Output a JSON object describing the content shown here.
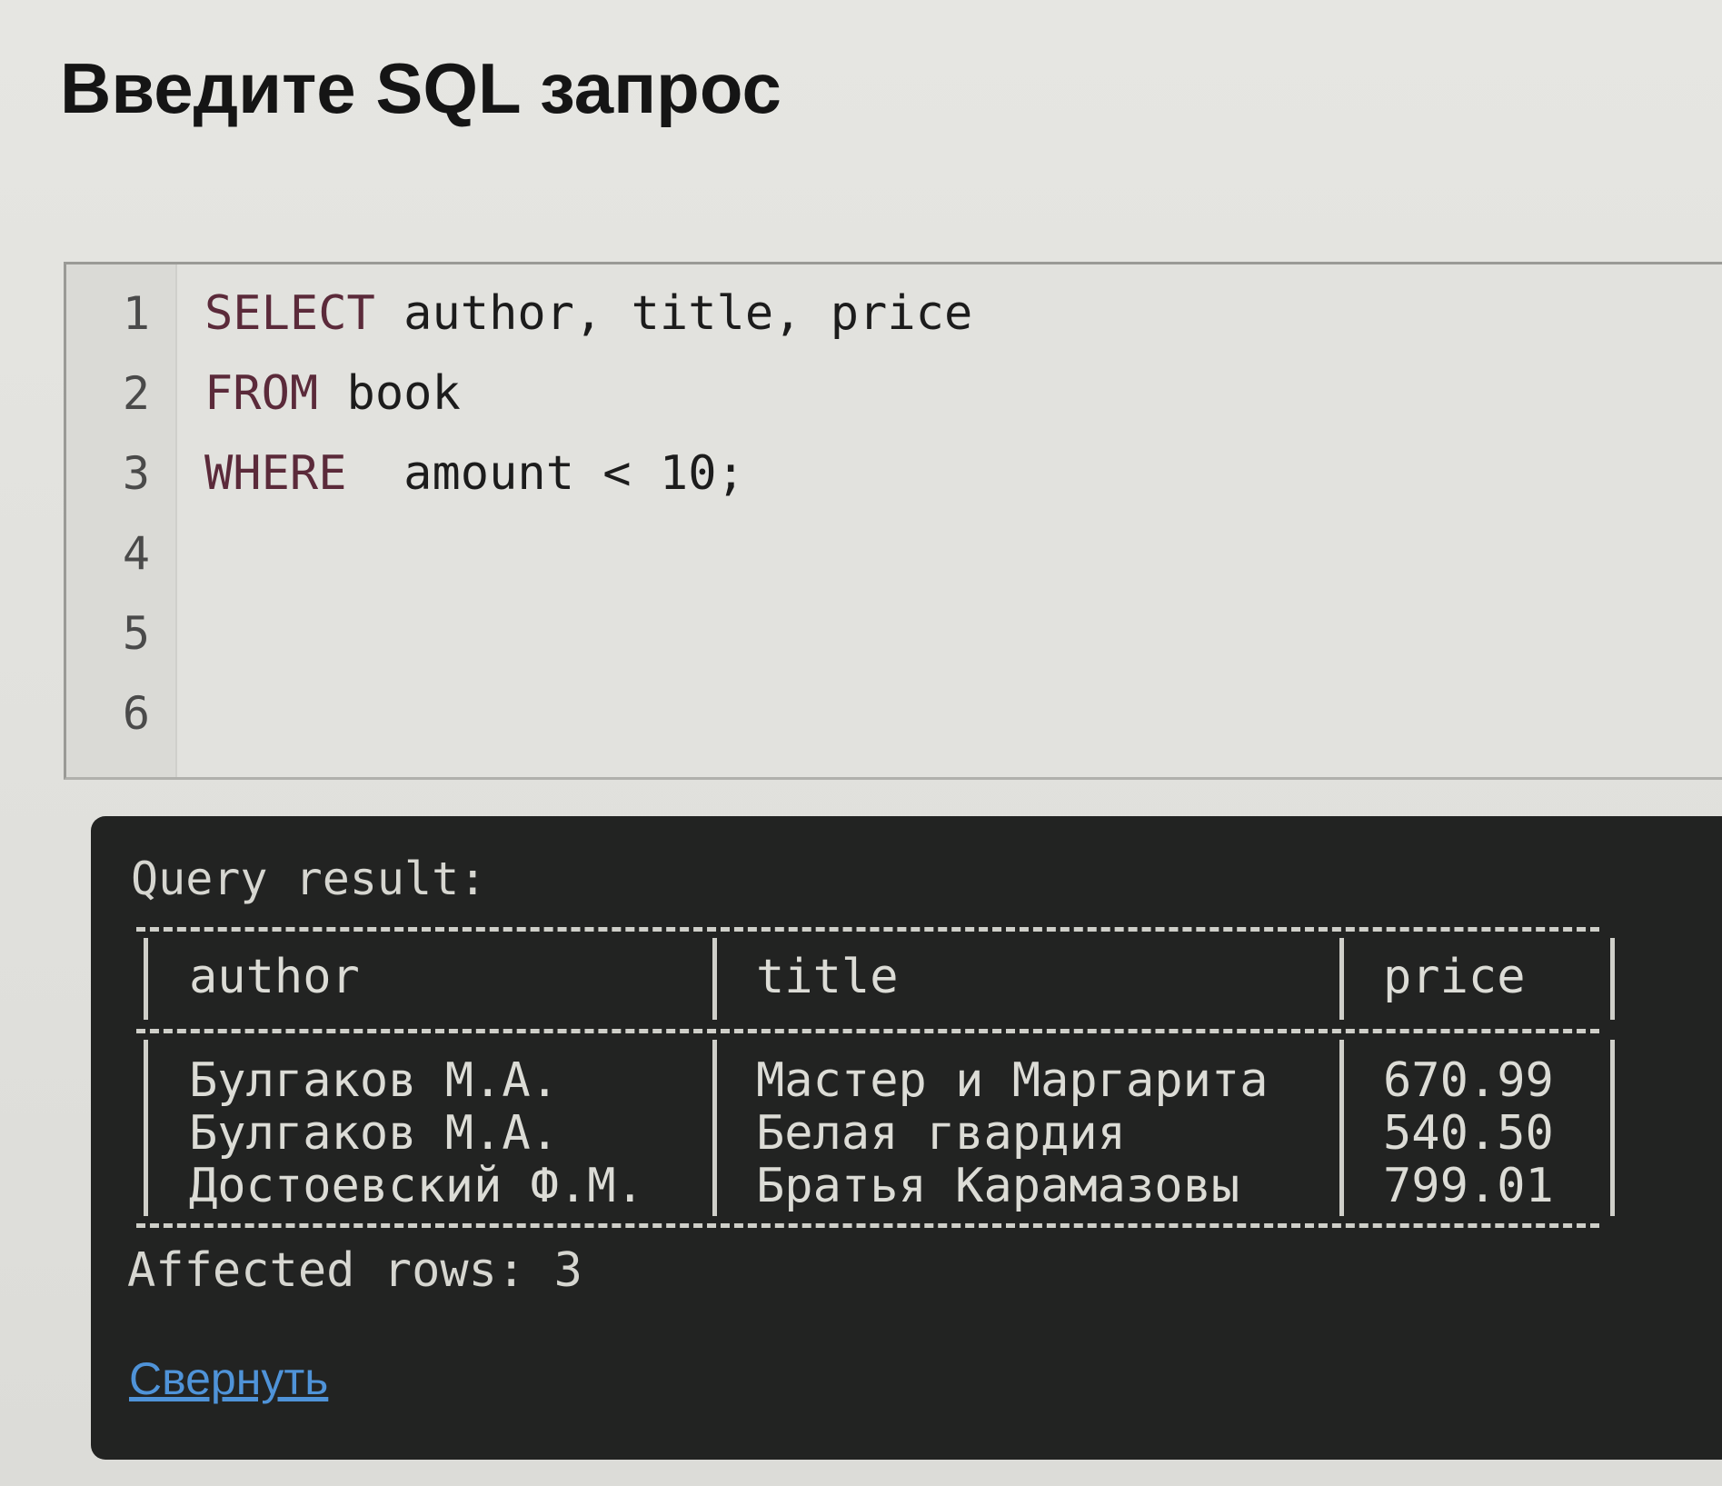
{
  "page": {
    "title": "Введите SQL запрос"
  },
  "editor": {
    "lines": [
      {
        "num": "1",
        "keyword": "SELECT",
        "rest": " author, title, price"
      },
      {
        "num": "2",
        "keyword": "FROM",
        "rest": " book"
      },
      {
        "num": "3",
        "keyword": "WHERE",
        "rest": "  amount < 10;"
      },
      {
        "num": "4",
        "keyword": "",
        "rest": ""
      },
      {
        "num": "5",
        "keyword": "",
        "rest": ""
      },
      {
        "num": "6",
        "keyword": "",
        "rest": ""
      }
    ]
  },
  "result": {
    "heading": "Query result:",
    "columns": [
      "author",
      "title",
      "price"
    ],
    "rows": [
      [
        "Булгаков М.А.",
        "Мастер и Маргарита",
        "670.99"
      ],
      [
        "Булгаков М.А.",
        "Белая гвардия",
        "540.50"
      ],
      [
        "Достоевский Ф.М.",
        "Братья Карамазовы",
        "799.01"
      ]
    ],
    "affected_rows": "Affected rows: 3",
    "collapse_label": "Свернуть"
  },
  "colors": {
    "keyword": "#5b2a3a",
    "console_bg": "#222322",
    "link": "#4f93d8"
  }
}
